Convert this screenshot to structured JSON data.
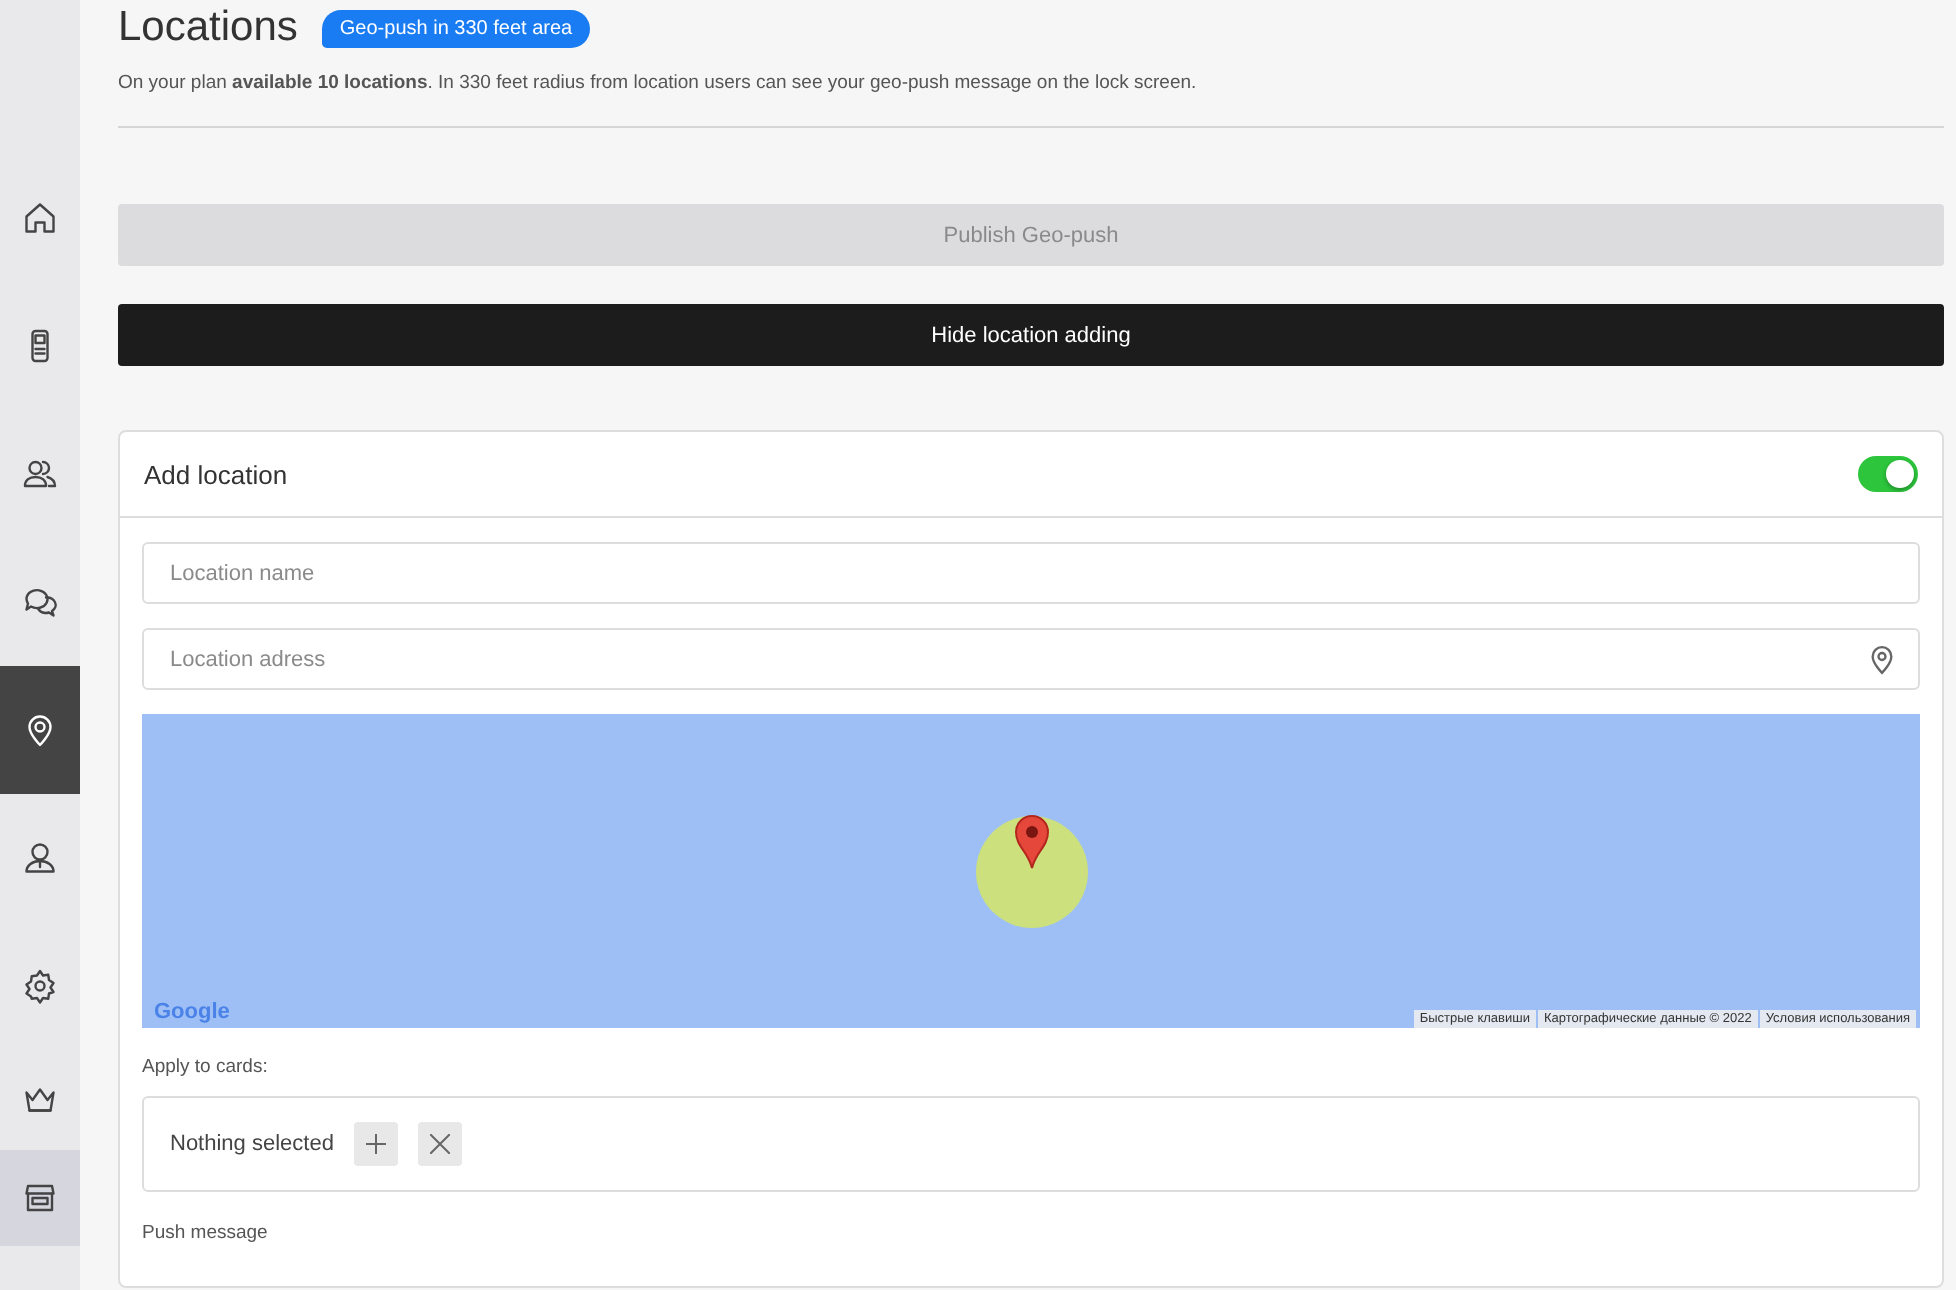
{
  "sidebar": {
    "items": [
      {
        "selected": false,
        "hovered": false
      },
      {
        "selected": false,
        "hovered": false
      },
      {
        "selected": false,
        "hovered": false
      },
      {
        "selected": false,
        "hovered": false
      },
      {
        "selected": true,
        "hovered": false
      },
      {
        "selected": false,
        "hovered": false
      },
      {
        "selected": false,
        "hovered": false
      },
      {
        "selected": false,
        "hovered": false
      },
      {
        "selected": false,
        "hovered": true
      }
    ]
  },
  "header": {
    "title": "Locations",
    "badge": "Geo-push in 330 feet area",
    "description": "On your plan **available 10 locations**. In 330 feet radius from location users can see your geo-push message on the lock screen."
  },
  "publish_button": {
    "label": "Publish Geo-push",
    "disabled": true
  },
  "hide_button": {
    "label": "Hide location adding"
  },
  "add_location": {
    "title": "Add location",
    "enabled": true,
    "name_field": {
      "placeholder": "Location name"
    },
    "address_field": {
      "placeholder": "Location adress"
    },
    "map": {
      "logo": "Google",
      "attributions": [
        "Быстрые клавиши",
        "Картографические данные © 2022",
        "Условия использования"
      ]
    },
    "apply_label": "Apply to cards:",
    "cards_selector": {
      "value": "Nothing selected"
    },
    "push_message_label": "Push message"
  }
}
